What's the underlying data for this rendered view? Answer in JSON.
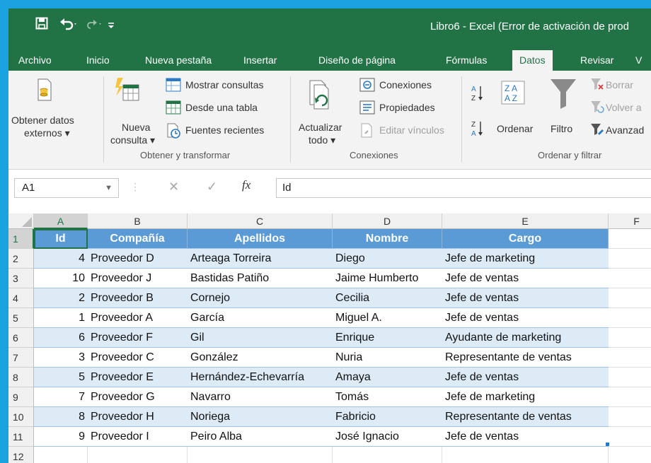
{
  "window": {
    "title": "Libro6 - Excel (Error de activación de prod"
  },
  "colors": {
    "accent": "#217346",
    "table_header": "#5b9bd5",
    "table_band": "#ddebf7",
    "background": "#1aa3e0"
  },
  "quick_access": {
    "save_icon": "save-icon",
    "undo_icon": "undo-icon",
    "redo_icon": "redo-icon",
    "customize_icon": "customize-icon"
  },
  "tabs": [
    "Archivo",
    "Inicio",
    "Nueva pestaña",
    "Insertar",
    "Diseño de página",
    "Fórmulas",
    "Datos",
    "Revisar",
    "V"
  ],
  "active_tab": "Datos",
  "ribbon": {
    "obtener_datos_1": "Obtener datos",
    "obtener_datos_2": "externos",
    "nueva_1": "Nueva",
    "nueva_2": "consulta",
    "mostrar_consultas": "Mostrar consultas",
    "desde_tabla": "Desde una tabla",
    "fuentes_recientes": "Fuentes recientes",
    "group_obtener": "Obtener y transformar",
    "actualizar_1": "Actualizar",
    "actualizar_2": "todo",
    "conexiones": "Conexiones",
    "propiedades": "Propiedades",
    "editar_vinculos": "Editar vínculos",
    "group_conexiones": "Conexiones",
    "ordenar": "Ordenar",
    "filtro": "Filtro",
    "borrar": "Borrar",
    "volver": "Volver a",
    "avanzadas": "Avanzad",
    "group_ordenar": "Ordenar y filtrar"
  },
  "formula_bar": {
    "name_box": "A1",
    "fx": "fx",
    "formula": "Id"
  },
  "grid": {
    "columns": [
      "A",
      "B",
      "C",
      "D",
      "E",
      "F"
    ],
    "rows": [
      "1",
      "2",
      "3",
      "4",
      "5",
      "6",
      "7",
      "8",
      "9",
      "10",
      "11",
      "12"
    ],
    "headers": [
      "Id",
      "Compañía",
      "Apellidos",
      "Nombre",
      "Cargo"
    ],
    "data": [
      [
        "4",
        "Proveedor D",
        "Arteaga Torreira",
        "Diego",
        "Jefe de marketing"
      ],
      [
        "10",
        "Proveedor J",
        "Bastidas Patiño",
        "Jaime Humberto",
        "Jefe de ventas"
      ],
      [
        "2",
        "Proveedor B",
        "Cornejo",
        "Cecilia",
        "Jefe de ventas"
      ],
      [
        "1",
        "Proveedor A",
        "García",
        "Miguel A.",
        "Jefe de ventas"
      ],
      [
        "6",
        "Proveedor F",
        "Gil",
        "Enrique",
        "Ayudante de marketing"
      ],
      [
        "3",
        "Proveedor C",
        "González",
        "Nuria",
        "Representante de ventas"
      ],
      [
        "5",
        "Proveedor E",
        "Hernández-Echevarría",
        "Amaya",
        "Jefe de ventas"
      ],
      [
        "7",
        "Proveedor G",
        "Navarro",
        "Tomás",
        "Jefe de marketing"
      ],
      [
        "8",
        "Proveedor H",
        "Noriega",
        "Fabricio",
        "Representante de ventas"
      ],
      [
        "9",
        "Proveedor I",
        "Peiro Alba",
        "José Ignacio",
        "Jefe de ventas"
      ]
    ]
  }
}
